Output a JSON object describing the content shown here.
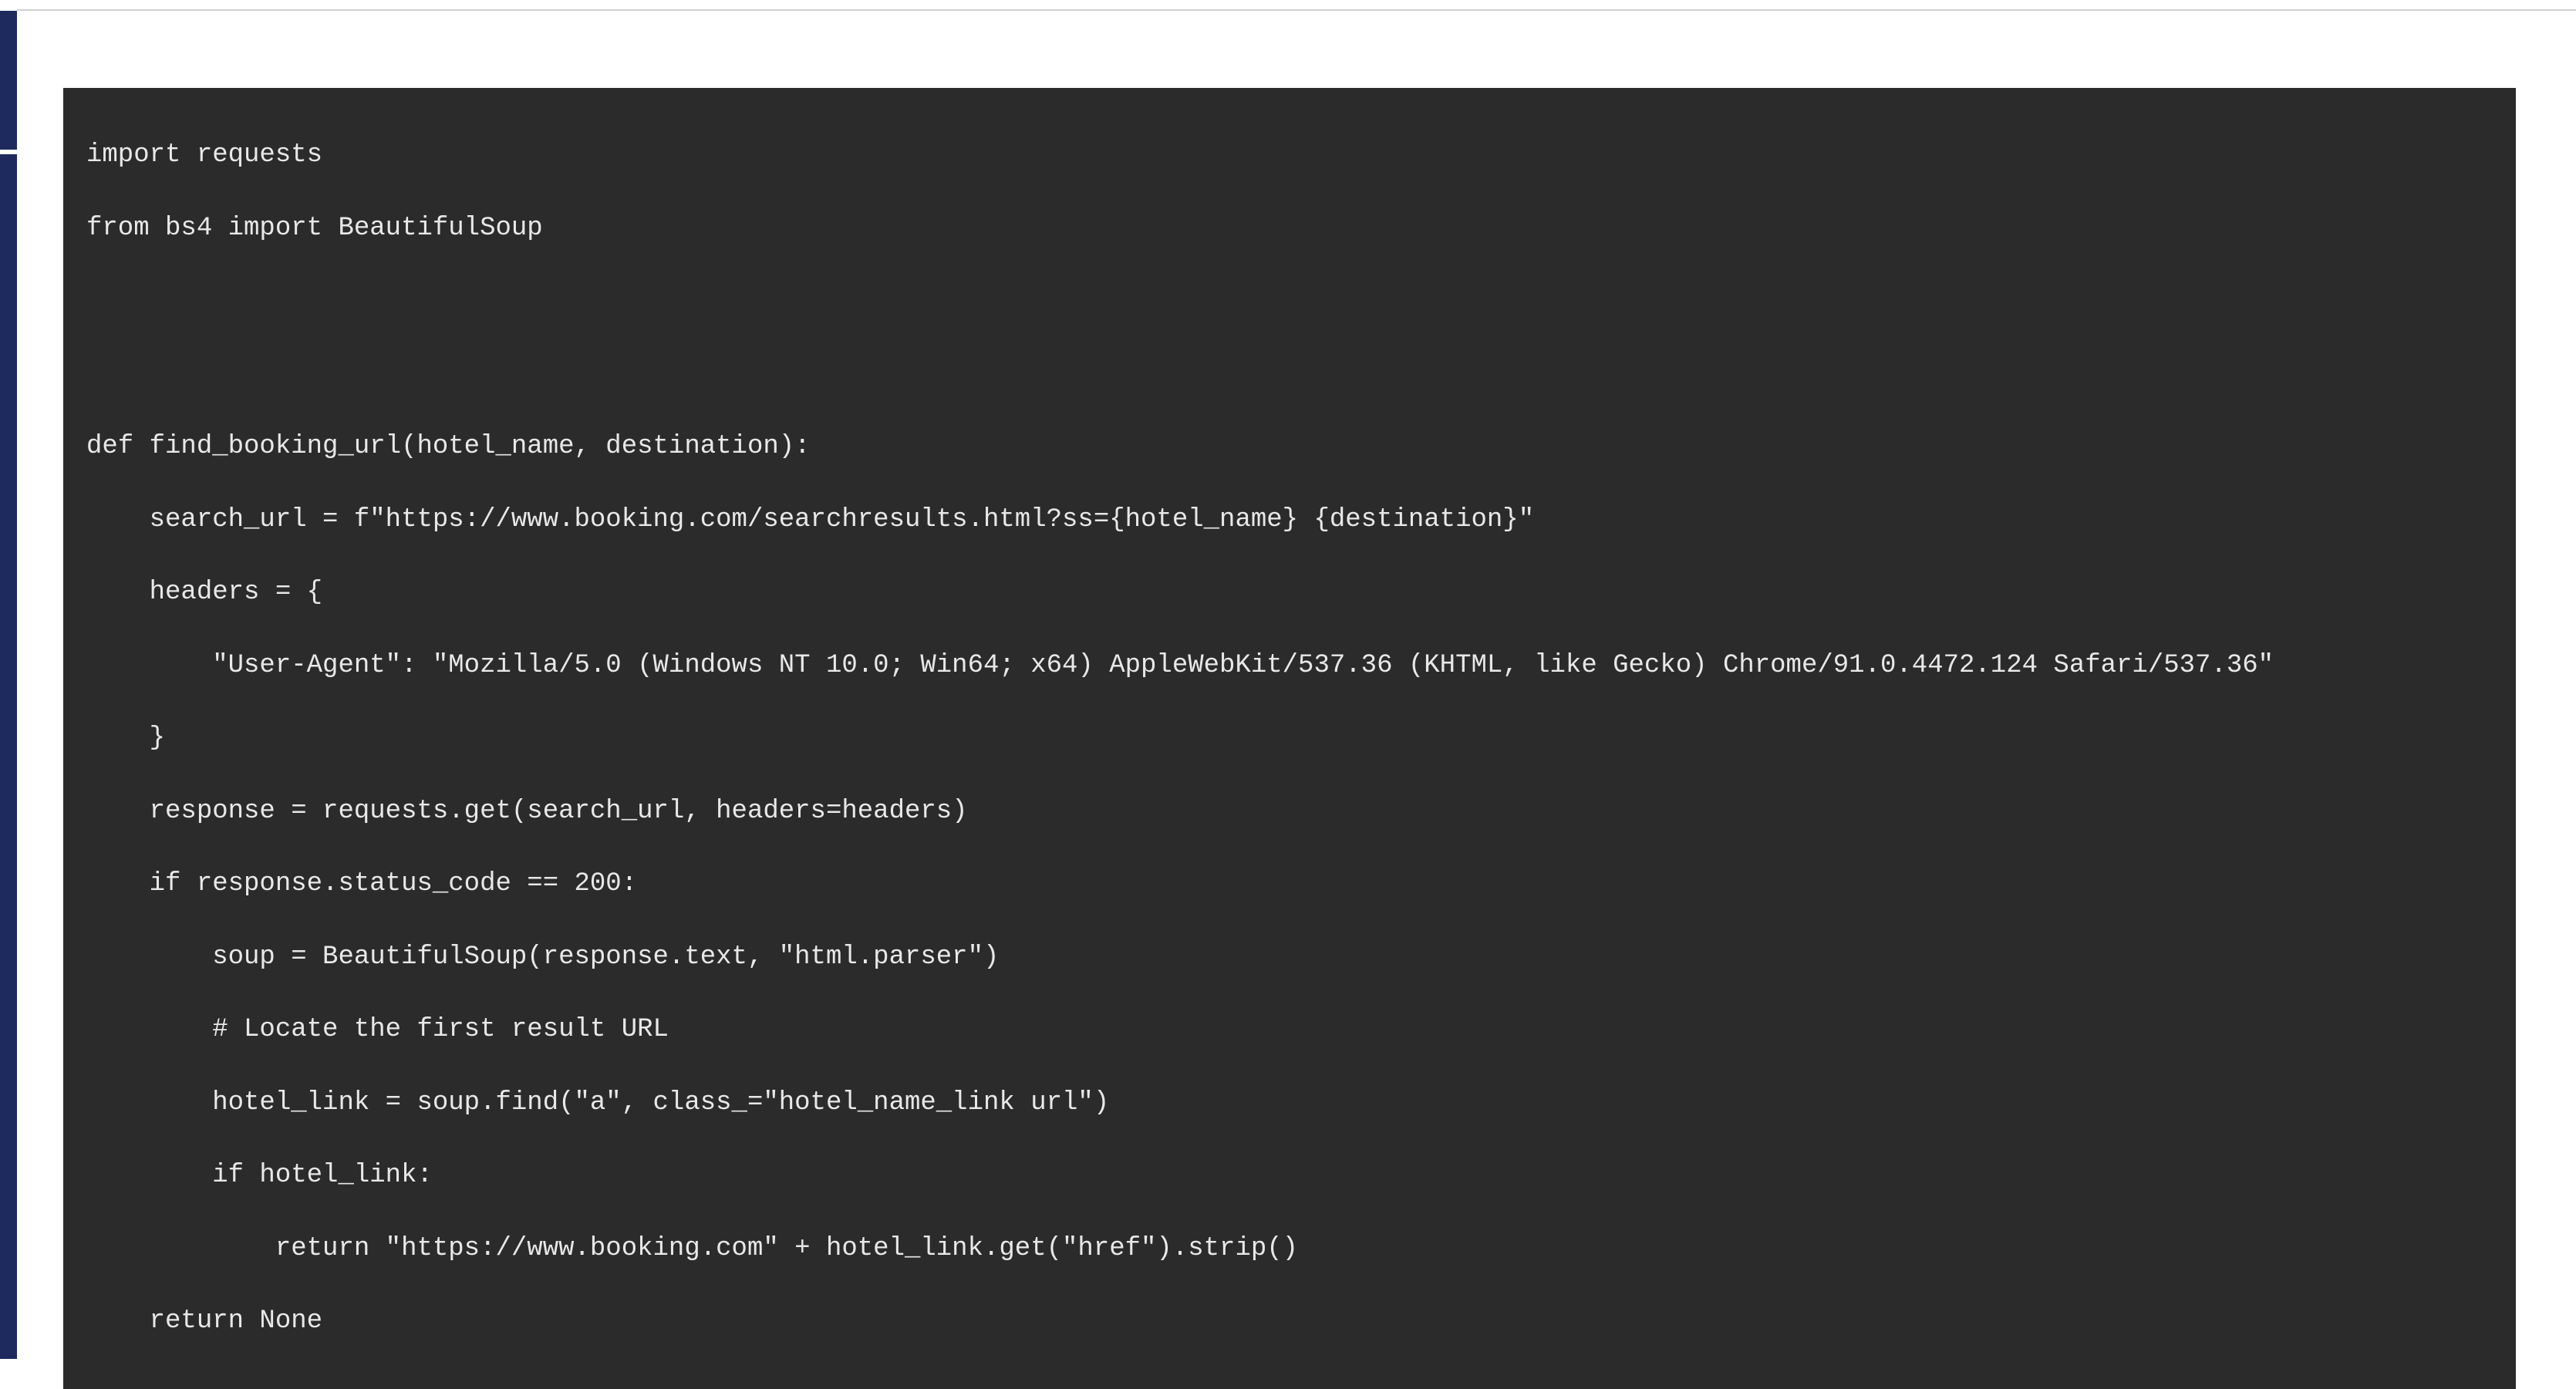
{
  "code": {
    "lines": [
      "import requests",
      "from bs4 import BeautifulSoup",
      "",
      "",
      "def find_booking_url(hotel_name, destination):",
      "    search_url = f\"https://www.booking.com/searchresults.html?ss={hotel_name} {destination}\"",
      "    headers = {",
      "        \"User-Agent\": \"Mozilla/5.0 (Windows NT 10.0; Win64; x64) AppleWebKit/537.36 (KHTML, like Gecko) Chrome/91.0.4472.124 Safari/537.36\"",
      "    }",
      "    response = requests.get(search_url, headers=headers)",
      "    if response.status_code == 200:",
      "        soup = BeautifulSoup(response.text, \"html.parser\")",
      "        # Locate the first result URL",
      "        hotel_link = soup.find(\"a\", class_=\"hotel_name_link url\")",
      "        if hotel_link:",
      "            return \"https://www.booking.com\" + hotel_link.get(\"href\").strip()",
      "    return None"
    ]
  }
}
